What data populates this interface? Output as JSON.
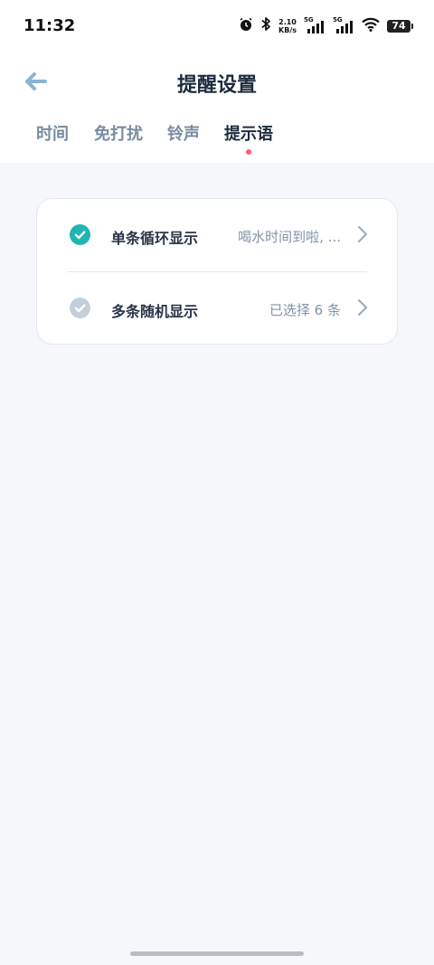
{
  "status_bar": {
    "time": "11:32",
    "net_speed_value": "2.10",
    "net_speed_unit": "KB/s",
    "signal1_label": "5G",
    "signal2_label": "5G",
    "battery": "74"
  },
  "header": {
    "title": "提醒设置"
  },
  "tabs": [
    {
      "label": "时间",
      "active": false
    },
    {
      "label": "免打扰",
      "active": false
    },
    {
      "label": "铃声",
      "active": false
    },
    {
      "label": "提示语",
      "active": true
    }
  ],
  "options": [
    {
      "label": "单条循环显示",
      "value": "喝水时间到啦, ...",
      "selected": true
    },
    {
      "label": "多条随机显示",
      "value": "已选择 6 条",
      "selected": false
    }
  ],
  "colors": {
    "accent": "#1fb5b2",
    "tab_indicator": "#ff5b6b",
    "back_arrow": "#8ab4d0",
    "background": "#f5f7fb"
  }
}
